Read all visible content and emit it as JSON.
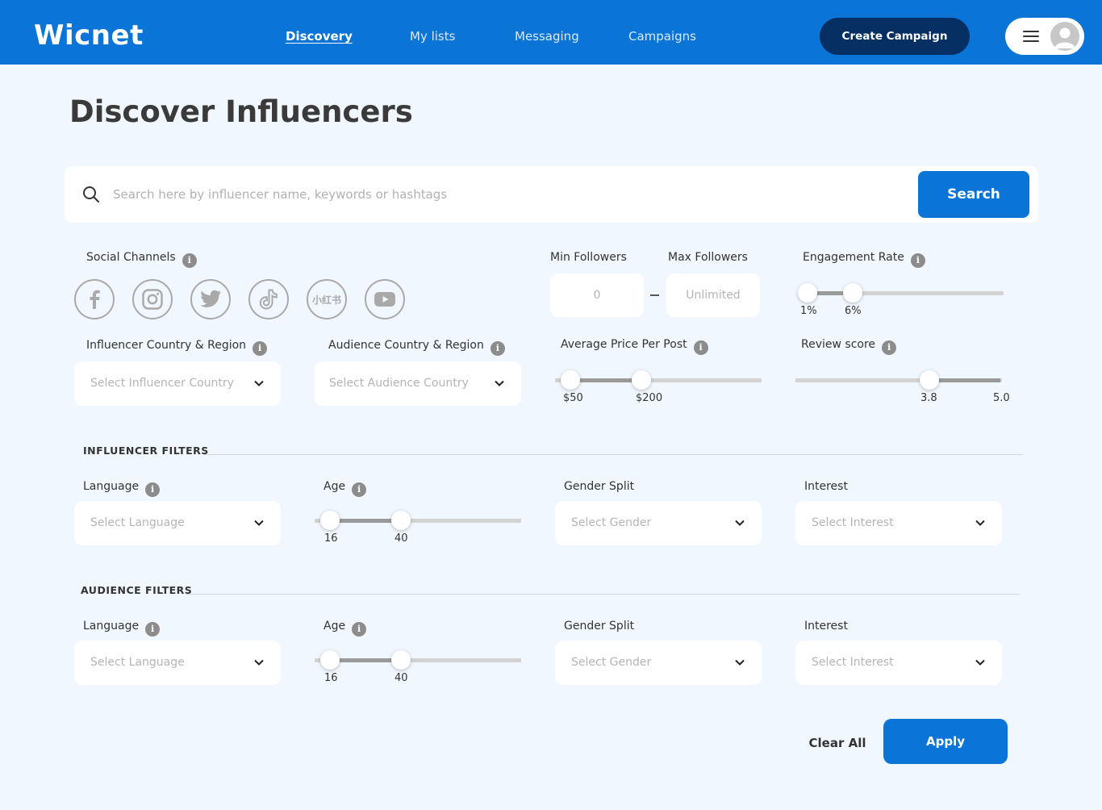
{
  "header": {
    "logo": "Wicnet",
    "nav": [
      {
        "label": "Discovery"
      },
      {
        "label": "My lists"
      },
      {
        "label": "Messaging"
      },
      {
        "label": "Campaigns"
      }
    ],
    "create_campaign": "Create Campaign"
  },
  "page_title": "Discover Influencers",
  "search": {
    "placeholder": "Search here by influencer name, keywords or hashtags",
    "button": "Search"
  },
  "social_channels": {
    "label": "Social Channels",
    "icons": [
      "facebook-icon",
      "instagram-icon",
      "twitter-icon",
      "tiktok-icon",
      "xiaohongshu-icon",
      "youtube-icon"
    ],
    "xhs_text": "小红书"
  },
  "followers": {
    "min_label": "Min Followers",
    "max_label": "Max Followers",
    "min_placeholder": "0",
    "max_placeholder": "Unlimited"
  },
  "engagement_rate": {
    "label": "Engagement Rate",
    "min": "1%",
    "max": "6%"
  },
  "influencer_country": {
    "label": "Influencer Country & Region",
    "placeholder": "Select Influencer Country"
  },
  "audience_country": {
    "label": "Audience Country & Region",
    "placeholder": "Select Audience Country"
  },
  "avg_price": {
    "label": "Average Price Per Post",
    "min": "$50",
    "max": "$200"
  },
  "review_score": {
    "label": "Review score",
    "value": "3.8",
    "max": "5.0"
  },
  "influencer_filters": {
    "title": "Influencer Filters",
    "language_label": "Language",
    "language_placeholder": "Select Language",
    "age_label": "Age",
    "age_min": "16",
    "age_max": "40",
    "gender_label": "Gender Split",
    "gender_placeholder": "Select Gender",
    "interest_label": "Interest",
    "interest_placeholder": "Select Interest"
  },
  "audience_filters": {
    "title": "Audience Filters",
    "language_label": "Language",
    "language_placeholder": "Select Language",
    "age_label": "Age",
    "age_min": "16",
    "age_max": "40",
    "gender_label": "Gender Split",
    "gender_placeholder": "Select Gender",
    "interest_label": "Interest",
    "interest_placeholder": "Select Interest"
  },
  "actions": {
    "clear": "Clear All",
    "apply": "Apply"
  },
  "colors": {
    "primary": "#0a74d7",
    "dark": "#062f63",
    "background": "#f1f7fe"
  }
}
